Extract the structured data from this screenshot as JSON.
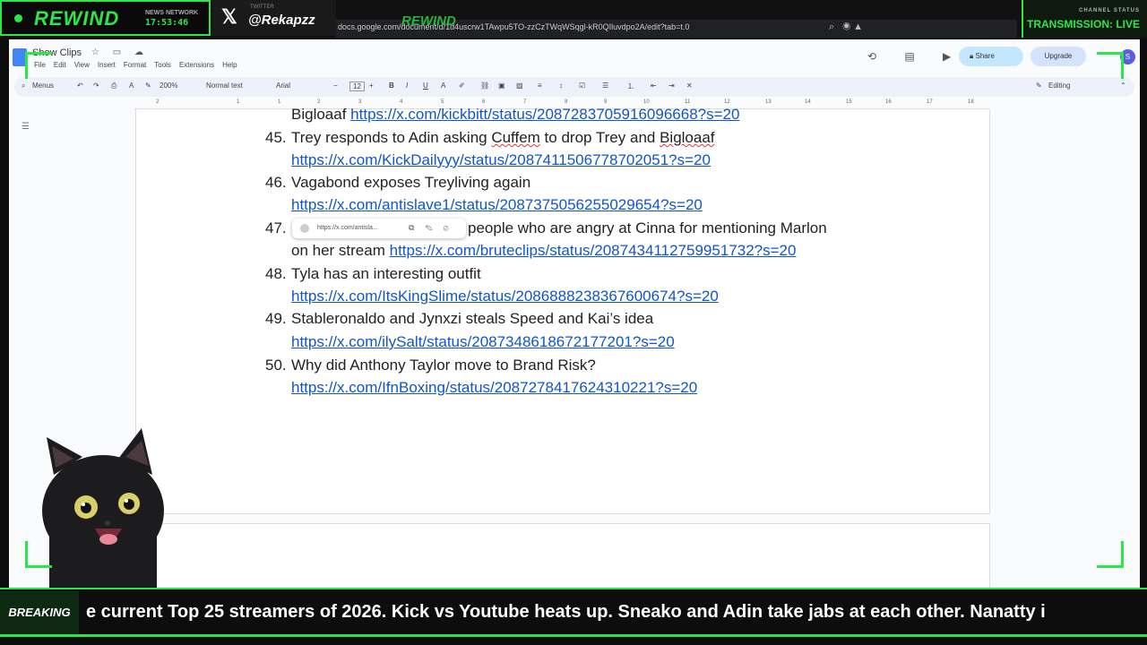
{
  "overlay": {
    "brand": "REWIND",
    "news_label": "NEWS NETWORK",
    "clock": "17:53:46",
    "twitter_small": "TWITTER",
    "handle": "@Rekapzz",
    "url": "docs.google.com/document/d/1d4uscrw1TAwpu5TO-zzCzTWqWSqgl-kR0QIluvdpo2A/edit?tab=t.0",
    "channel_status_label": "CHANNEL STATUS",
    "channel_status_value": "TRANSMISSION: LIVE",
    "accent": "#2ee64a"
  },
  "docs": {
    "title": "Show Clips",
    "menu": [
      "File",
      "Edit",
      "View",
      "Insert",
      "Format",
      "Tools",
      "Extensions",
      "Help"
    ],
    "share_label": "Share",
    "upgrade_label": "Upgrade",
    "avatar_letter": "S",
    "toolbar": {
      "menus_label": "Menus",
      "zoom": "200%",
      "style": "Normal text",
      "font": "Arial",
      "font_size": "12",
      "mode": "Editing"
    },
    "ruler_ticks": [
      "2",
      "1",
      "1",
      "2",
      "3",
      "4",
      "5",
      "6",
      "7",
      "8",
      "9",
      "10",
      "11",
      "12",
      "13",
      "14",
      "15",
      "16",
      "17",
      "18"
    ]
  },
  "content": {
    "partial_prefix": "Bigloaaf",
    "partial_link": "https://x.com/kickbitt/status/2087283705916096668?s=20",
    "items": [
      {
        "num": "45.",
        "text_before": "Trey responds to Adin asking ",
        "spell1": "Cuffem",
        "text_mid": " to drop Trey and ",
        "spell2": "Bigloaaf",
        "link": "https://x.com/KickDailyyy/status/2087411506778702051?s=20"
      },
      {
        "num": "46.",
        "text": "Vagabond exposes Treyliving again",
        "link": "https://x.com/antislave1/status/2087375056255029654?s=20"
      },
      {
        "num": "47.",
        "text": "people who are angry at Cinna for mentioning Marlon",
        "text2": "on her stream",
        "link": "https://x.com/bruteclips/status/2087434112759951732?s=20"
      },
      {
        "num": "48.",
        "text": "Tyla has an interesting outfit",
        "link": "https://x.com/ItsKingSlime/status/2086888238367600674?s=20"
      },
      {
        "num": "49.",
        "text": "Stableronaldo and Jynxzi steals Speed and Kai’s idea",
        "link": "https://x.com/ilySalt/status/2087348618672177201?s=20"
      },
      {
        "num": "50.",
        "text": "Why did Anthony Taylor move to Brand Risk?",
        "link": "https://x.com/IfnBoxing/status/2087278417624310221?s=20"
      }
    ],
    "link_popup_url": "https://x.com/antisla..."
  },
  "ticker": {
    "label": "BREAKING",
    "text": "e current Top 25 streamers of 2026. Kick vs Youtube heats up. Sneako and Adin take jabs at each other. Nanatty i"
  }
}
